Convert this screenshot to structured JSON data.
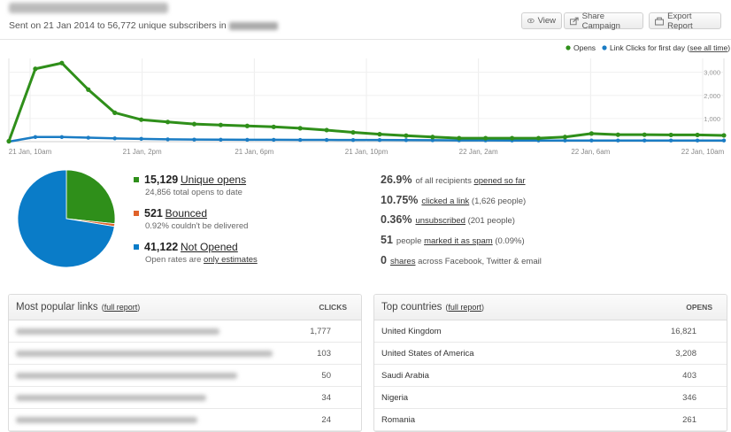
{
  "header": {
    "sent_line": "Sent on 21 Jan 2014 to 56,772 unique subscribers in",
    "buttons": {
      "view": "View",
      "share": "Share Campaign",
      "export": "Export Report"
    }
  },
  "colors": {
    "opens": "#2f8f1a",
    "clicks": "#1a7cc4",
    "bounced": "#e0622a",
    "not_opened": "#0a7cc8"
  },
  "chart_data": {
    "type": "line",
    "legend": [
      "Opens",
      "Link Clicks for first day"
    ],
    "legend_link": "see all time",
    "x_labels": [
      "21 Jan, 10am",
      "21 Jan, 2pm",
      "21 Jan, 6pm",
      "21 Jan, 10pm",
      "22 Jan, 2am",
      "22 Jan, 6am",
      "22 Jan, 10am"
    ],
    "y_ticks": [
      "3,000",
      "2,000",
      "1,000"
    ],
    "ylim": [
      0,
      3600
    ],
    "series": [
      {
        "name": "Opens",
        "values": [
          20,
          3150,
          3400,
          2250,
          1250,
          950,
          850,
          760,
          720,
          680,
          640,
          580,
          500,
          400,
          320,
          260,
          200,
          150,
          150,
          150,
          150,
          200,
          350,
          300,
          300,
          290,
          290,
          270
        ]
      },
      {
        "name": "Link Clicks for first day",
        "values": [
          0,
          200,
          200,
          170,
          140,
          120,
          100,
          90,
          85,
          80,
          80,
          75,
          75,
          70,
          70,
          65,
          60,
          55,
          55,
          50,
          50,
          50,
          50,
          50,
          50,
          50,
          50,
          50
        ]
      }
    ]
  },
  "pie": [
    {
      "name": "Unique opens",
      "value": 15129
    },
    {
      "name": "Bounced",
      "value": 521
    },
    {
      "name": "Not Opened",
      "value": 41122
    }
  ],
  "stats": {
    "opens_num": "15,129",
    "opens_label": "Unique opens",
    "opens_sub": "24,856 total opens to date",
    "bounced_num": "521",
    "bounced_label": "Bounced",
    "bounced_sub": "0.92% couldn't be delivered",
    "notopen_num": "41,122",
    "notopen_label": "Not Opened",
    "notopen_sub_pre": "Open rates are",
    "notopen_sub_link": "only estimates"
  },
  "right_stats": [
    {
      "big": "26.9%",
      "pre": "of all recipients",
      "link": "opened so far",
      "post": ""
    },
    {
      "big": "10.75%",
      "pre": "",
      "link": "clicked a link",
      "post": "(1,626 people)"
    },
    {
      "big": "0.36%",
      "pre": "",
      "link": "unsubscribed",
      "post": "(201 people)"
    },
    {
      "big": "51",
      "pre": "people",
      "link": "marked it as spam",
      "post": "(0.09%)"
    },
    {
      "big": "0",
      "pre": "",
      "link": "shares",
      "post": "across Facebook, Twitter & email"
    }
  ],
  "links_panel": {
    "title": "Most popular links",
    "full": "full report",
    "col": "CLICKS",
    "rows": [
      {
        "v": "1,777"
      },
      {
        "v": "103"
      },
      {
        "v": "50"
      },
      {
        "v": "34"
      },
      {
        "v": "24"
      }
    ]
  },
  "countries_panel": {
    "title": "Top countries",
    "full": "full report",
    "col": "OPENS",
    "rows": [
      {
        "name": "United Kingdom",
        "v": "16,821"
      },
      {
        "name": "United States of America",
        "v": "3,208"
      },
      {
        "name": "Saudi Arabia",
        "v": "403"
      },
      {
        "name": "Nigeria",
        "v": "346"
      },
      {
        "name": "Romania",
        "v": "261"
      }
    ]
  }
}
